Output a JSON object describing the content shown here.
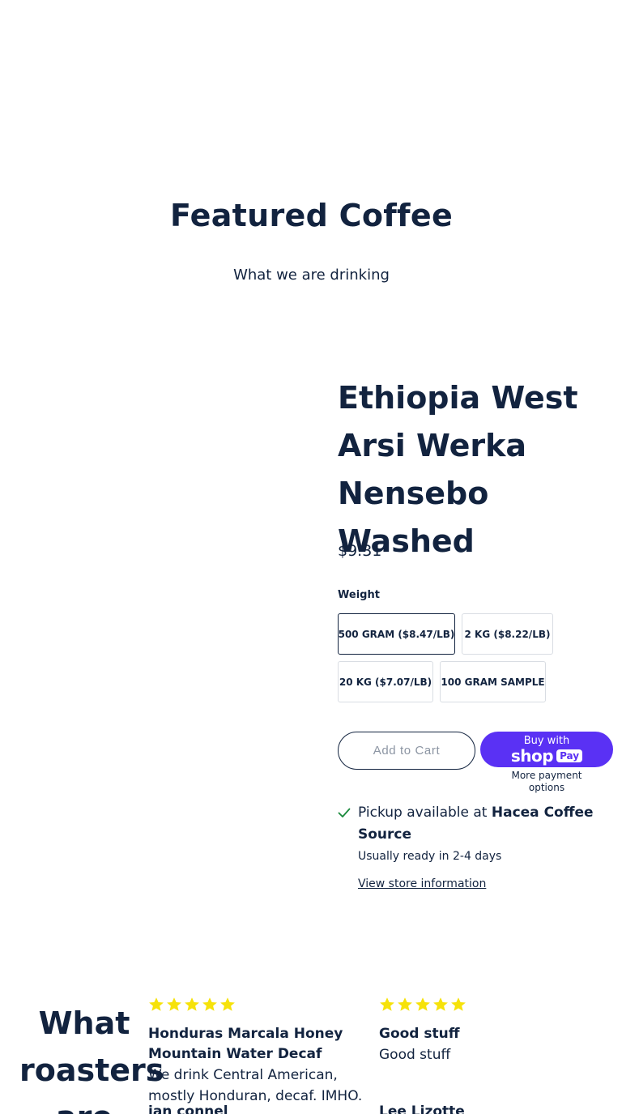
{
  "featured": {
    "title": "Featured Coffee",
    "subtitle": "What we are drinking"
  },
  "product": {
    "title": "Ethiopia West Arsi Werka Nensebo Washed",
    "price": "$9.31",
    "weight_label": "Weight",
    "variants": [
      {
        "label": "500 GRAM ($8.47/LB)",
        "selected": true
      },
      {
        "label": "2 KG ($8.22/LB)",
        "selected": false
      },
      {
        "label": "20 KG ($7.07/LB)",
        "selected": false
      },
      {
        "label": "100 GRAM SAMPLE",
        "selected": false
      }
    ],
    "add_to_cart": "Add to Cart",
    "shop_pay": {
      "buy_with": "Buy with",
      "brand": "shop",
      "brand_badge": "Pay"
    },
    "more_payment": "More payment options"
  },
  "pickup": {
    "prefix": "Pickup available at ",
    "location": "Hacea Coffee Source",
    "ready": "Usually ready in 2-4 days",
    "store_link": "View store information",
    "check_color": "#1a8a3c"
  },
  "reviews_section": {
    "heading": "What roasters are",
    "star_color": "#f6e20a",
    "reviews": [
      {
        "rating": 5,
        "title": "Honduras Marcala Honey Mountain Water Decaf",
        "body": "We drink Central American, mostly Honduran, decaf. IMHO.",
        "author": "ian connel"
      },
      {
        "rating": 5,
        "title": "Good stuff",
        "body": "Good stuff",
        "author": "Lee Lizotte"
      }
    ]
  },
  "colors": {
    "text": "#12233f",
    "shop_pay": "#5a31f4",
    "border": "#d9dde3"
  }
}
